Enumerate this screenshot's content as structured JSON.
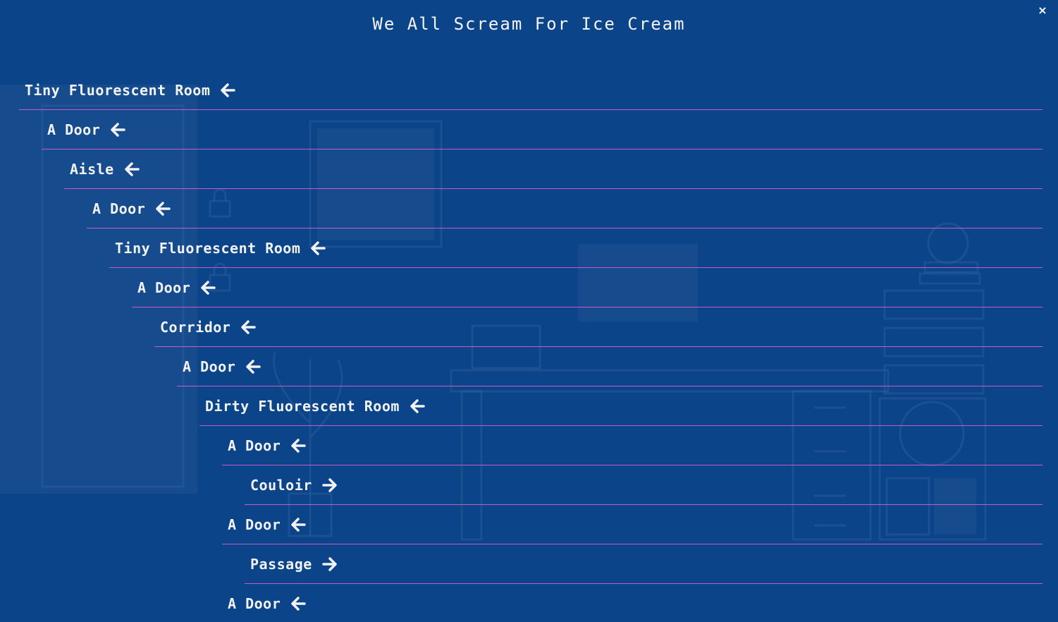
{
  "header": {
    "title": "We All Scream For Ice Cream",
    "close_label": "×"
  },
  "colors": {
    "background": "#0b4488",
    "divider": "#c75bc9",
    "text": "#f2f2f2"
  },
  "history": [
    {
      "label": "Tiny Fluorescent Room",
      "depth": 0,
      "direction": "back",
      "icon": "arrow-left-icon"
    },
    {
      "label": "A Door",
      "depth": 1,
      "direction": "back",
      "icon": "arrow-left-icon"
    },
    {
      "label": "Aisle",
      "depth": 2,
      "direction": "back",
      "icon": "arrow-left-icon"
    },
    {
      "label": "A Door",
      "depth": 3,
      "direction": "back",
      "icon": "arrow-left-icon"
    },
    {
      "label": "Tiny Fluorescent Room",
      "depth": 4,
      "direction": "back",
      "icon": "arrow-left-icon"
    },
    {
      "label": "A Door",
      "depth": 5,
      "direction": "back",
      "icon": "arrow-left-icon"
    },
    {
      "label": "Corridor",
      "depth": 6,
      "direction": "back",
      "icon": "arrow-left-icon"
    },
    {
      "label": "A Door",
      "depth": 7,
      "direction": "back",
      "icon": "arrow-left-icon"
    },
    {
      "label": "Dirty Fluorescent Room",
      "depth": 8,
      "direction": "back",
      "icon": "arrow-left-icon"
    },
    {
      "label": "A Door",
      "depth": 9,
      "direction": "back",
      "icon": "arrow-left-icon"
    },
    {
      "label": "Couloir",
      "depth": 10,
      "direction": "forward",
      "icon": "arrow-right-icon"
    },
    {
      "label": "A Door",
      "depth": 9,
      "direction": "back",
      "icon": "arrow-left-icon"
    },
    {
      "label": "Passage",
      "depth": 10,
      "direction": "forward",
      "icon": "arrow-right-icon"
    },
    {
      "label": "A Door",
      "depth": 9,
      "direction": "back",
      "icon": "arrow-left-icon"
    }
  ]
}
